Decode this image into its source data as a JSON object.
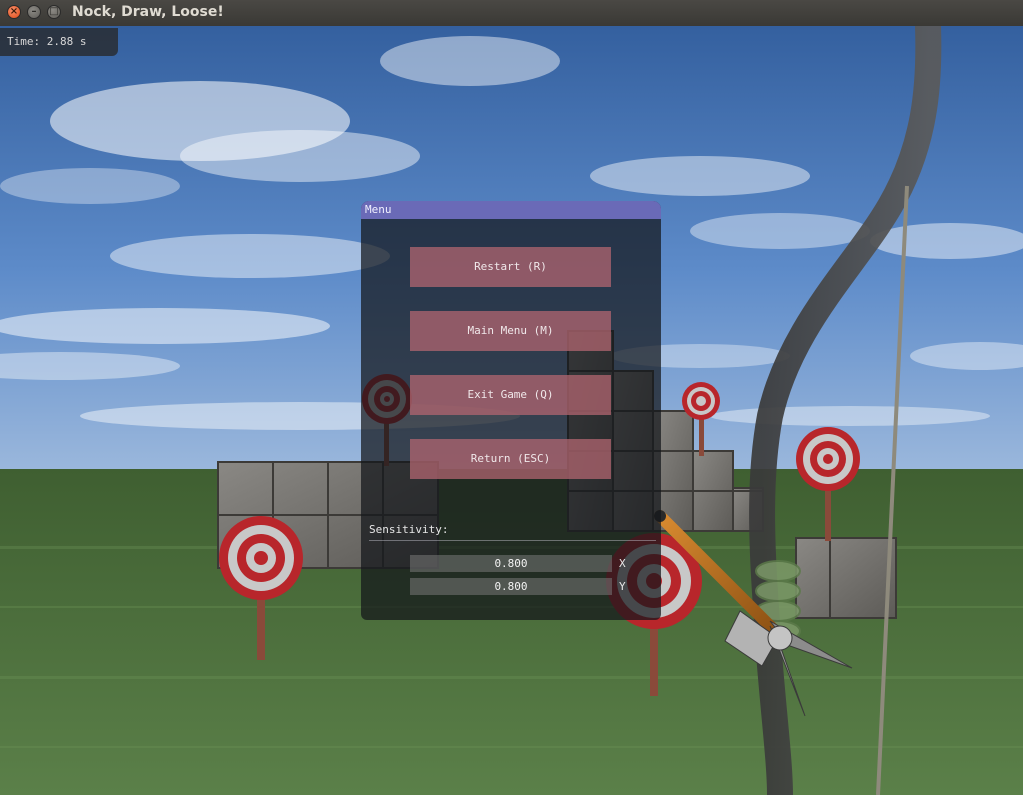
{
  "window": {
    "title": "Nock, Draw, Loose!",
    "close_glyph": "×",
    "min_glyph": "–",
    "max_glyph": "□"
  },
  "hud": {
    "time_text": "Time: 2.88 s"
  },
  "menu": {
    "title": "Menu",
    "buttons": {
      "restart": "Restart (R)",
      "main_menu": "Main Menu (M)",
      "exit": "Exit Game (Q)",
      "return": "Return (ESC)"
    },
    "sensitivity_label": "Sensitivity:",
    "sensitivity_x": "0.800",
    "sensitivity_y": "0.800",
    "axis_x": "X",
    "axis_y": "Y"
  },
  "colors": {
    "menu_title_bar": "#6a6ab7",
    "menu_button": "#b26670",
    "sky": "#4f7fc4",
    "grass": "#4e6e3a",
    "target_red": "#b8262b"
  }
}
